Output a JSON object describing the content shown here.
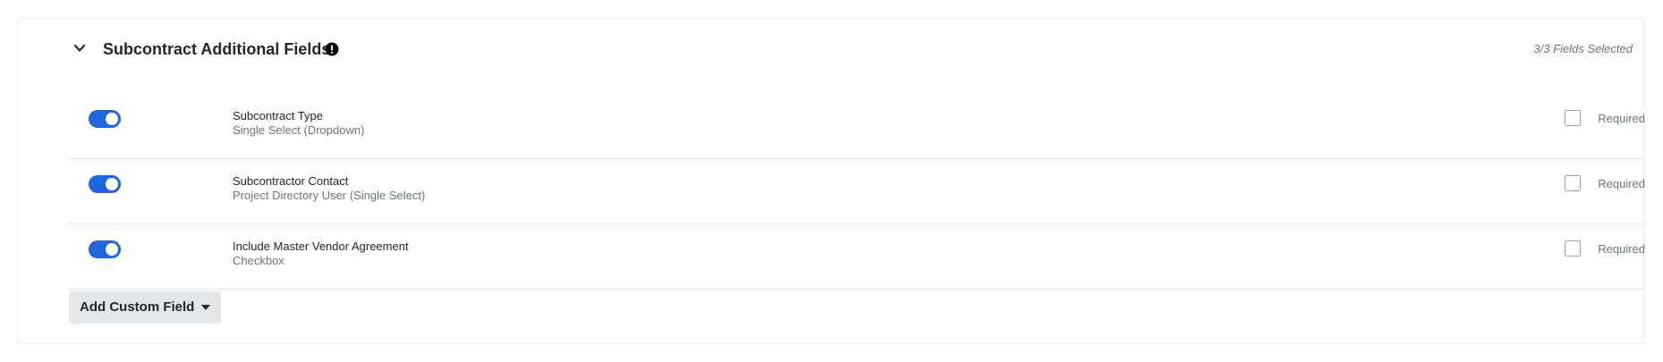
{
  "section": {
    "title": "Subcontract Additional Fields",
    "fields_selected": "3/3 Fields Selected",
    "expanded": true
  },
  "fields": [
    {
      "name": "Subcontract Type",
      "type": "Single Select (Dropdown)",
      "enabled": true,
      "required": false,
      "required_label": "Required"
    },
    {
      "name": "Subcontractor Contact",
      "type": "Project Directory User (Single Select)",
      "enabled": true,
      "required": false,
      "required_label": "Required"
    },
    {
      "name": "Include Master Vendor Agreement",
      "type": "Checkbox",
      "enabled": true,
      "required": false,
      "required_label": "Required"
    }
  ],
  "add_button": {
    "label": "Add Custom Field"
  },
  "icons": {
    "collapse": "chevron-down-icon",
    "info": "exclamation-circle-icon",
    "dropdown": "caret-down-icon"
  },
  "colors": {
    "toggle_on": "#2066df",
    "text_primary": "#232729",
    "text_secondary": "#6a767c",
    "button_bg": "#e4e7e9"
  }
}
